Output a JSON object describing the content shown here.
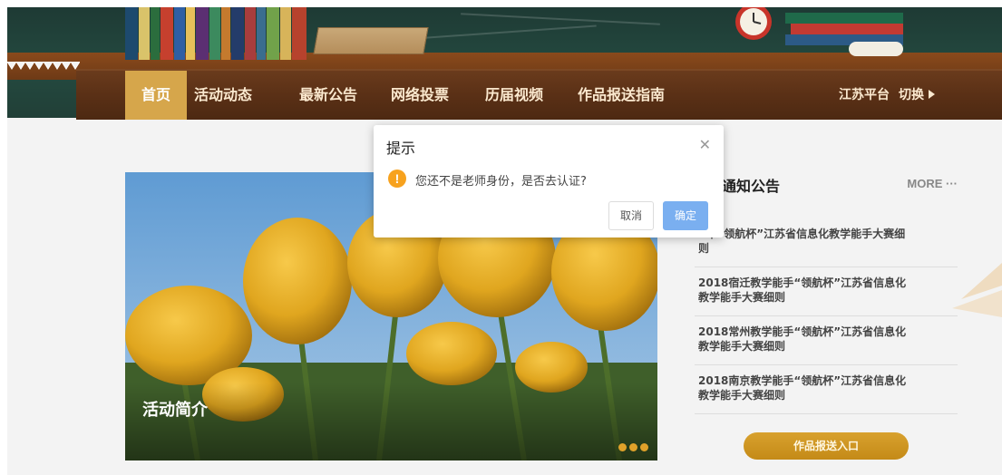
{
  "nav": {
    "items": [
      {
        "label": "首页",
        "active": true
      },
      {
        "label": "活动动态",
        "active": false
      },
      {
        "label": "最新公告",
        "active": false
      },
      {
        "label": "网络投票",
        "active": false
      },
      {
        "label": "历届视频",
        "active": false
      },
      {
        "label": "作品报送指南",
        "active": false
      }
    ],
    "platform_label": "江苏平台",
    "switch_label": "切换"
  },
  "hero": {
    "caption": "活动简介",
    "dots_count": 3
  },
  "notices": {
    "title": "通知公告",
    "more_label": "MORE ···",
    "items": [
      "3年“领航杯”江苏省信息化教学能手大赛细则",
      "2018宿迁教学能手“领航杯”江苏省信息化教学能手大赛细则",
      "2018常州教学能手“领航杯”江苏省信息化教学能手大赛细则",
      "2018南京教学能手“领航杯”江苏省信息化教学能手大赛细则"
    ],
    "submit_label": "作品报送入口"
  },
  "dialog": {
    "title": "提示",
    "message": "您还不是老师身份，是否去认证?",
    "cancel_label": "取消",
    "ok_label": "确定",
    "close_icon": "close-icon",
    "warning_icon": "warning-icon"
  },
  "colors": {
    "accent": "#d6a64b",
    "nav_bg": "#5a3016",
    "confirm_button": "#7aaff0",
    "warning": "#f7a21e"
  }
}
